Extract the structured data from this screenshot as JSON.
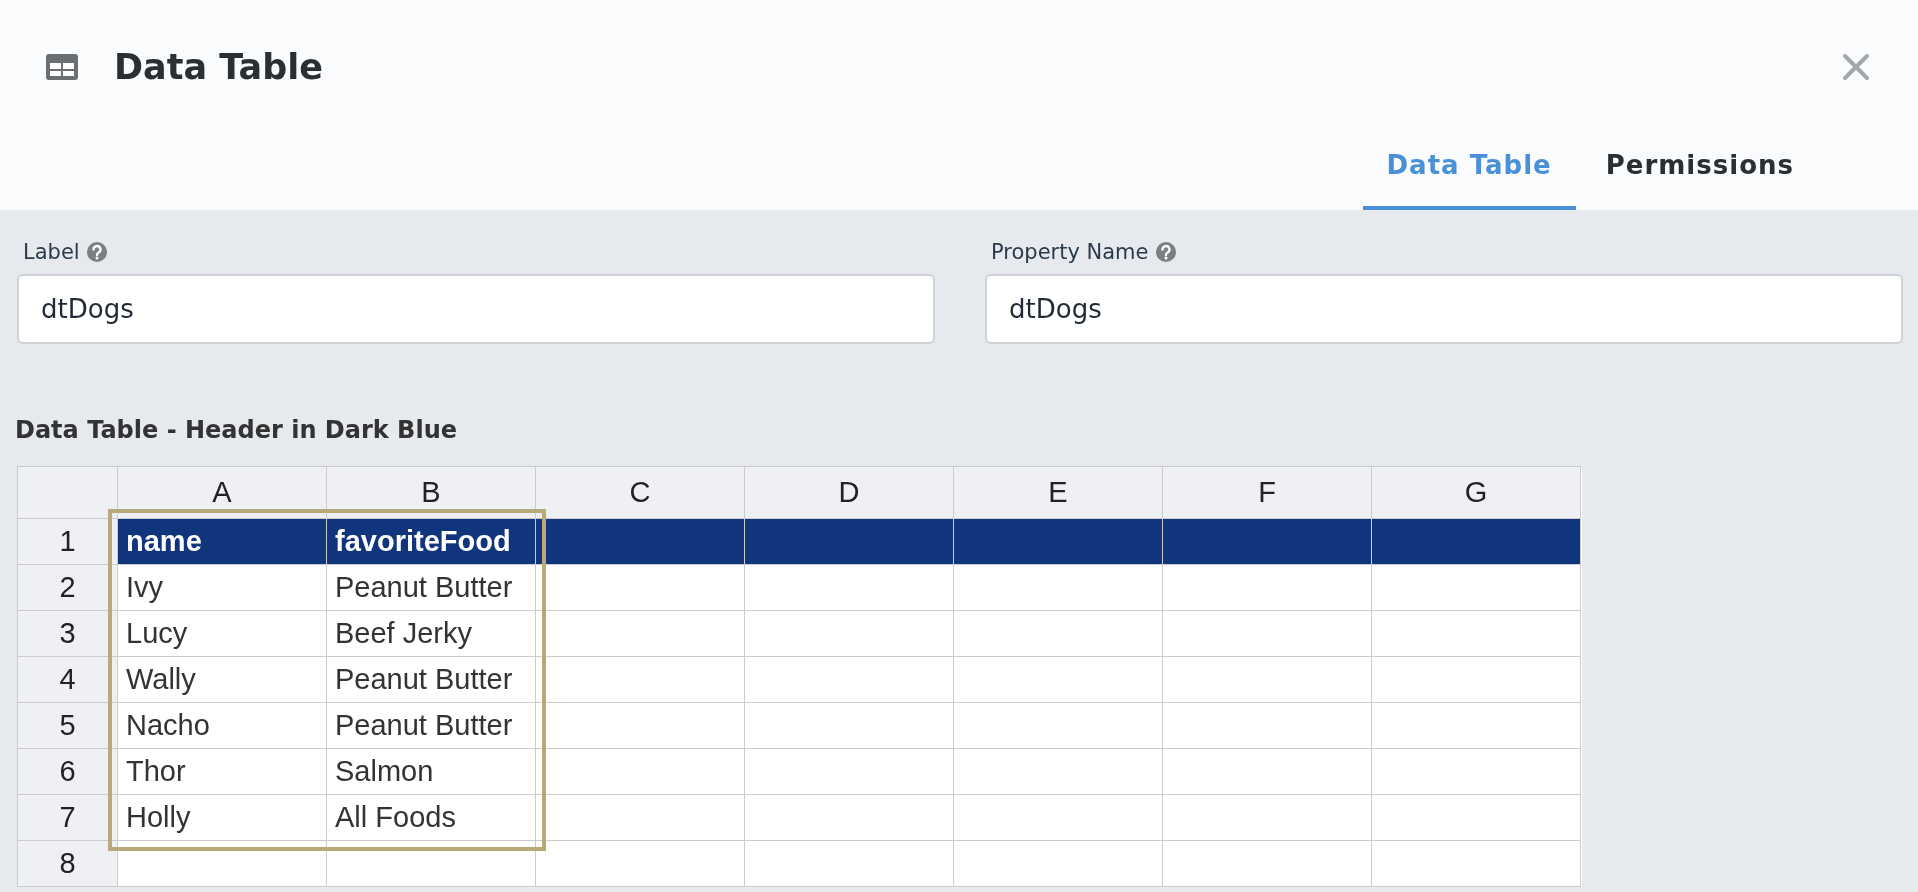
{
  "window": {
    "title": "Data Table"
  },
  "tabs": [
    {
      "label": "Data Table",
      "selected": true
    },
    {
      "label": "Permissions",
      "selected": false
    }
  ],
  "fields": [
    {
      "label": "Label",
      "value": "dtDogs"
    },
    {
      "label": "Property Name",
      "value": "dtDogs"
    }
  ],
  "table": {
    "caption": "Data Table - Header in Dark Blue",
    "data_outlined": true,
    "columns": [
      "A",
      "B",
      "C",
      "D",
      "E",
      "F",
      "G"
    ],
    "rows": [
      {
        "number": "1",
        "kind": "header",
        "cells": [
          "name",
          "favoriteFood"
        ]
      },
      {
        "number": "2",
        "kind": "data",
        "cells": [
          "Ivy",
          "Peanut Butter"
        ]
      },
      {
        "number": "3",
        "kind": "data",
        "cells": [
          "Lucy",
          "Beef Jerky"
        ]
      },
      {
        "number": "4",
        "kind": "data",
        "cells": [
          "Wally",
          "Peanut Butter"
        ]
      },
      {
        "number": "5",
        "kind": "data",
        "cells": [
          "Nacho",
          "Peanut Butter"
        ]
      },
      {
        "number": "6",
        "kind": "data",
        "cells": [
          "Thor",
          "Salmon"
        ]
      },
      {
        "number": "7",
        "kind": "data",
        "cells": [
          "Holly",
          "All Foods"
        ]
      },
      {
        "number": "8",
        "kind": "data"
      }
    ]
  }
}
